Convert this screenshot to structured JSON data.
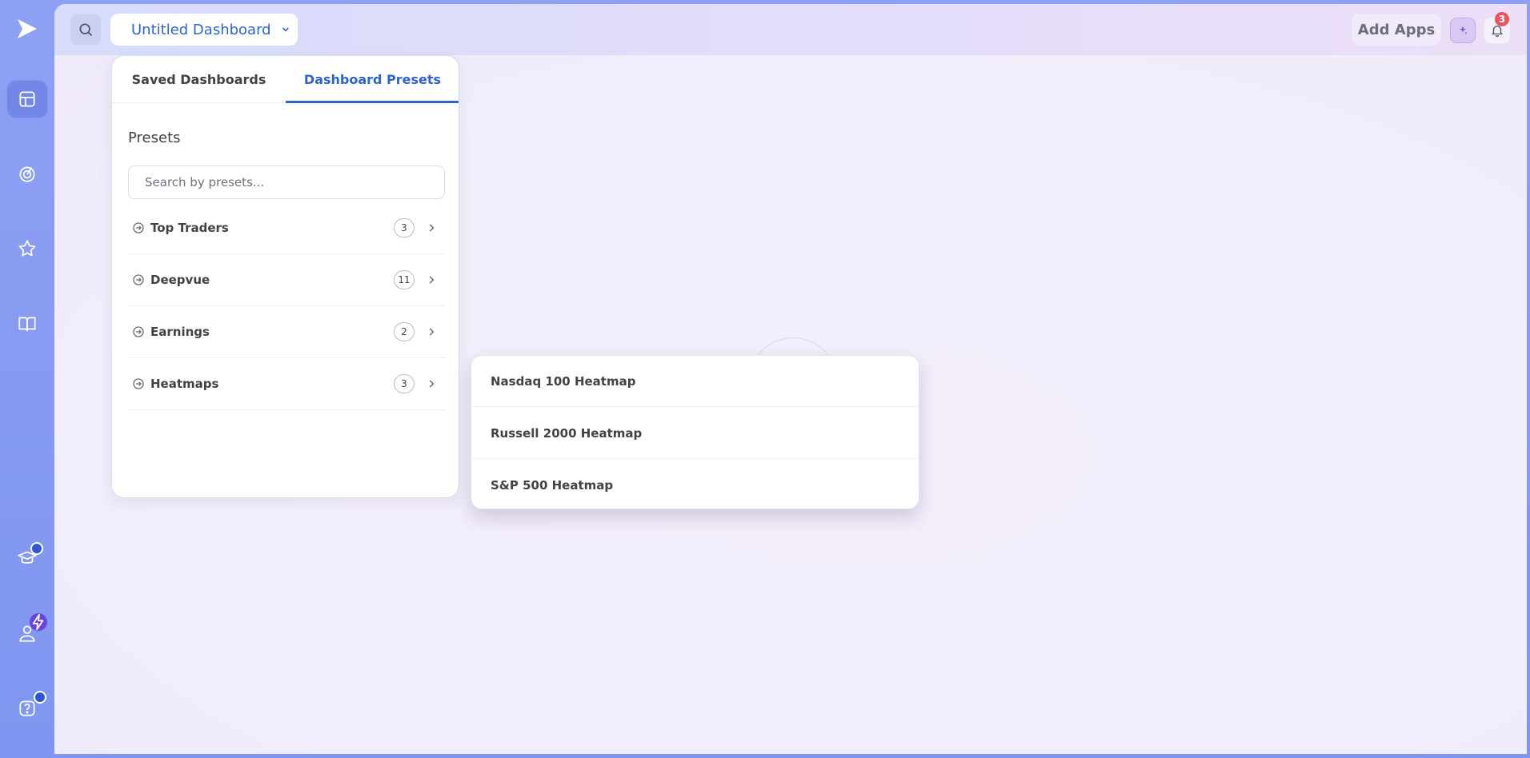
{
  "header": {
    "dashboard_title": "Untitled Dashboard",
    "add_apps_label": "Add Apps",
    "notification_count": "3"
  },
  "sidebar": {
    "items": [
      {
        "icon": "dashboard-icon",
        "active": true
      },
      {
        "icon": "target-icon"
      },
      {
        "icon": "star-icon"
      },
      {
        "icon": "book-icon"
      },
      {
        "icon": "graduation-cap-icon"
      },
      {
        "icon": "user-icon"
      },
      {
        "icon": "help-icon"
      }
    ]
  },
  "dashboard_panel": {
    "tabs": [
      {
        "label": "Saved Dashboards"
      },
      {
        "label": "Dashboard Presets",
        "active": true
      }
    ],
    "section_title": "Presets",
    "search_placeholder": "Search by presets...",
    "presets": [
      {
        "label": "Top Traders",
        "count": "3"
      },
      {
        "label": "Deepvue",
        "count": "11"
      },
      {
        "label": "Earnings",
        "count": "2"
      },
      {
        "label": "Heatmaps",
        "count": "3"
      }
    ]
  },
  "submenu": {
    "items": [
      {
        "label": "Nasdaq 100 Heatmap"
      },
      {
        "label": "Russell 2000 Heatmap"
      },
      {
        "label": "S&P 500 Heatmap"
      }
    ]
  },
  "colors": {
    "accent": "#2e64cf",
    "sidebar": "#8ea0f4",
    "badge_red": "#e8555d",
    "badge_purple": "#6a42e6"
  }
}
